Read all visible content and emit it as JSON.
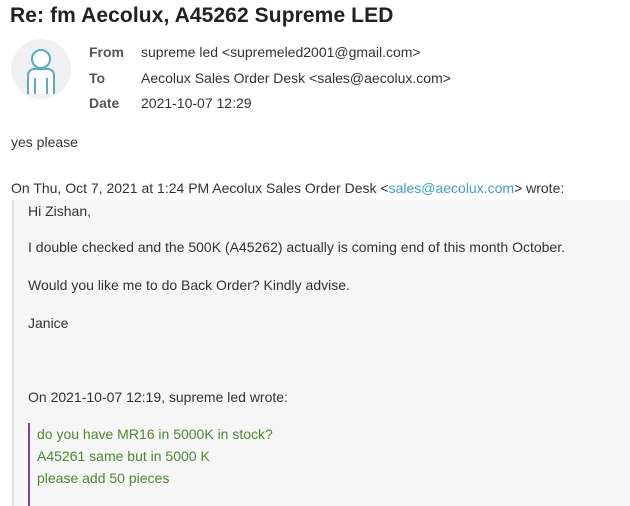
{
  "email": {
    "subject": "Re: fm Aecolux, A45262 Supreme LED",
    "headers": {
      "from_label": "From",
      "from_value": "supreme led <supremeled2001@gmail.com>",
      "to_label": "To",
      "to_value": "Aecolux Sales Order Desk <sales@aecolux.com>",
      "date_label": "Date",
      "date_value": "2021-10-07 12:29"
    },
    "reply_text": "yes please",
    "attribution": {
      "prefix": "On Thu, Oct 7, 2021 at 1:24 PM Aecolux Sales Order Desk <",
      "email_link": "sales@aecolux.com",
      "suffix": "> wrote:"
    },
    "quoted": {
      "greeting": "Hi Zishan,",
      "para1": "I double checked and the 500K (A45262) actually is coming end of this month October.",
      "para2": "Would you like me to do Back Order? Kindly advise.",
      "signature": "Janice",
      "inner_attribution": "On 2021-10-07 12:19, supreme led wrote:",
      "inner_lines": [
        "do you have MR16 in 5000K in stock?",
        "A45261 same but in 5000 K",
        "please add 50 pieces"
      ]
    }
  },
  "colors": {
    "link": "#3b9dc9",
    "inner_quote_text": "#4b8a2a",
    "inner_quote_bar": "#7b3fc4",
    "avatar_accent": "#5aa9c9"
  },
  "icons": {
    "avatar": "user-avatar-icon"
  }
}
